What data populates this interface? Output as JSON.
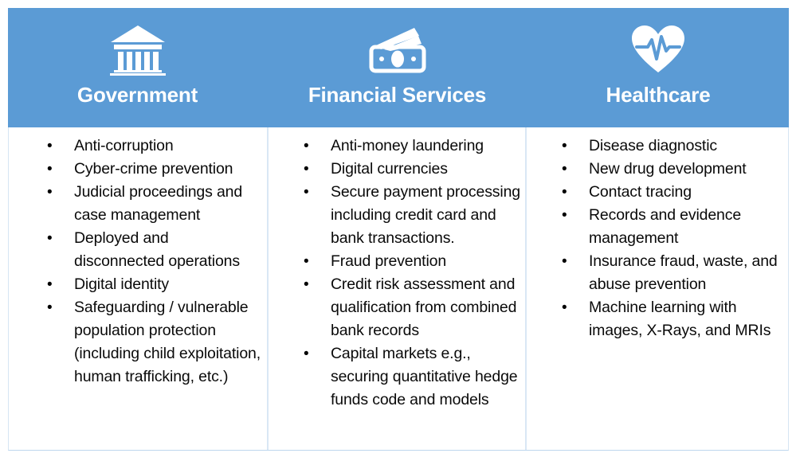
{
  "slide": {
    "header_bg_color": "#5B9BD5",
    "header_text_color": "#FFFFFF",
    "body_text_color": "#0A0A0A",
    "divider_color": "#D9E7F5"
  },
  "columns": [
    {
      "title": "Government",
      "icon": "government-building-icon",
      "items": [
        "Anti-corruption",
        "Cyber-crime prevention",
        "Judicial proceedings and case management",
        "Deployed and disconnected operations",
        "Digital identity",
        "Safeguarding / vulnerable population protection (including child exploitation, human trafficking, etc.)"
      ]
    },
    {
      "title": "Financial Services",
      "icon": "money-banknotes-icon",
      "items": [
        "Anti-money laundering",
        "Digital currencies",
        "Secure payment processing including credit card and bank transactions.",
        "Fraud prevention",
        "Credit risk assessment and qualification from combined bank records",
        "Capital markets e.g., securing quantitative hedge funds code and models"
      ]
    },
    {
      "title": "Healthcare",
      "icon": "heart-pulse-icon",
      "items": [
        "Disease diagnostic",
        "New drug development",
        "Contact tracing",
        "Records and evidence management",
        "Insurance fraud, waste, and abuse prevention",
        "Machine learning with images, X-Rays, and MRIs"
      ]
    }
  ]
}
